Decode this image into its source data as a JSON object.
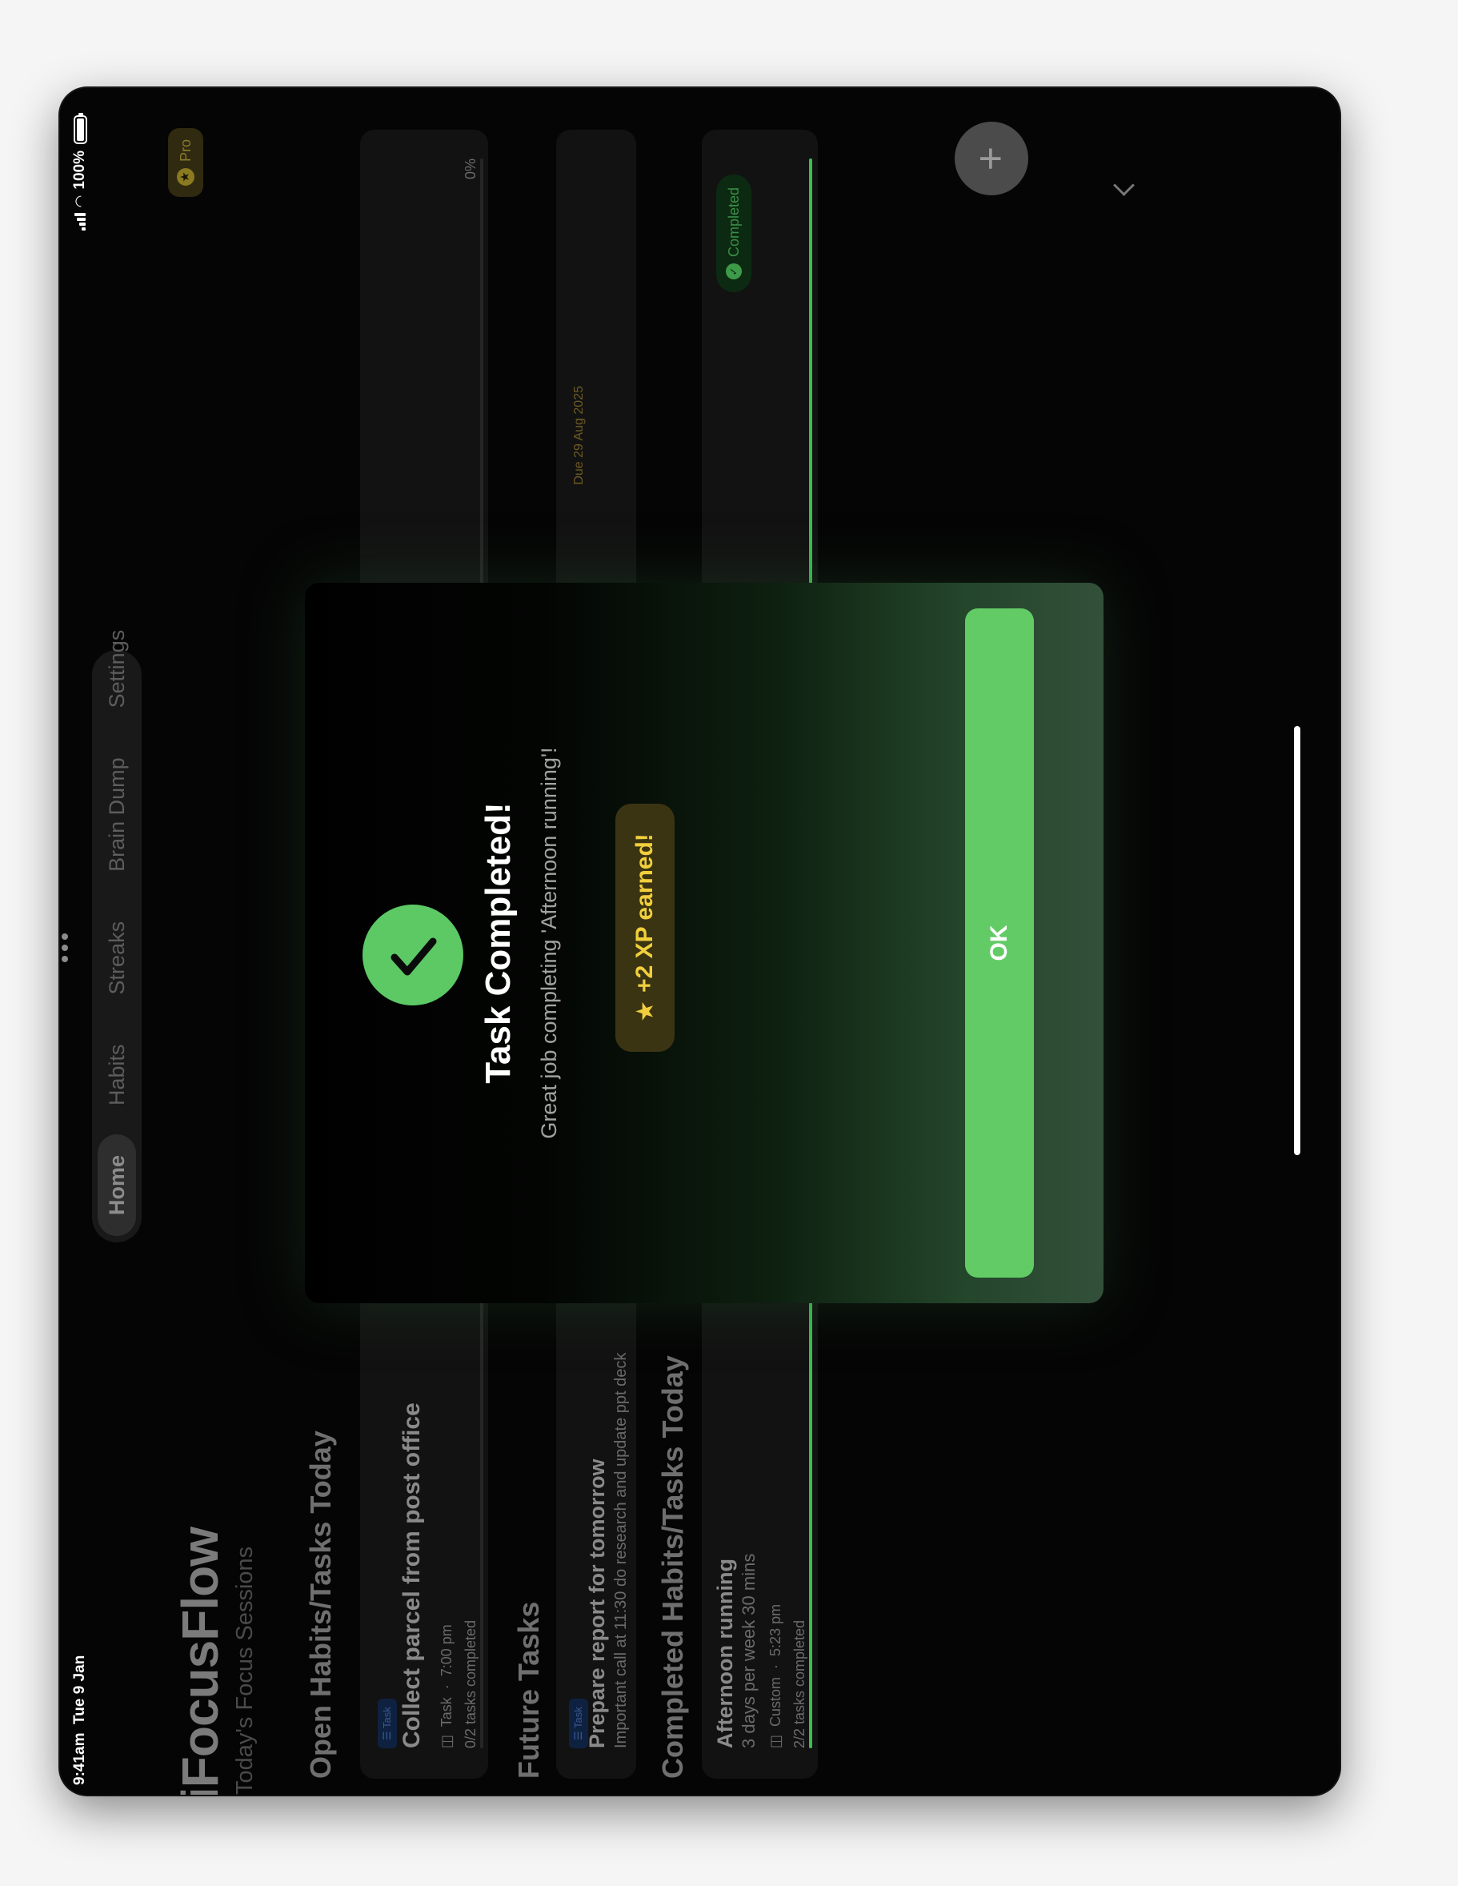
{
  "status_bar": {
    "time": "9:41am",
    "date": "Tue 9 Jan",
    "battery": "100%"
  },
  "nav": {
    "tabs": [
      "Home",
      "Habits",
      "Streaks",
      "Brain Dump",
      "Settings"
    ],
    "active": "Home"
  },
  "badge": {
    "label": "Pro"
  },
  "header": {
    "title": "iFocusFlow",
    "subtitle": "Today's Focus Sessions"
  },
  "sections": {
    "open": {
      "title": "Open Habits/Tasks Today",
      "card": {
        "chip": "Task",
        "title": "Collect parcel from post office",
        "type": "Task",
        "time": "7:00 pm",
        "progress_text": "0/2 tasks completed",
        "percent": "0%",
        "progress": 0
      }
    },
    "future": {
      "title": "Future Tasks",
      "card": {
        "chip": "Task",
        "title": "Prepare report for tomorrow",
        "description": "Important call at 11:30 do research and update ppt deck",
        "due": "Due 29 Aug 2025"
      }
    },
    "completed": {
      "title": "Completed Habits/Tasks Today",
      "card": {
        "title": "Afternoon running",
        "subtitle": "3 days per week 30 mins",
        "type": "Custom",
        "time": "5:23 pm",
        "progress_text": "2/2 tasks completed",
        "status": "Completed",
        "progress": 1
      }
    }
  },
  "modal": {
    "title": "Task Completed!",
    "message": "Great job completing 'Afternoon running'!",
    "xp": "+2 XP earned!",
    "ok": "OK"
  },
  "fab": {
    "label": "+"
  },
  "colors": {
    "accent": "#62cb66",
    "xp_text": "#f1cf3c",
    "background": "#050505"
  }
}
